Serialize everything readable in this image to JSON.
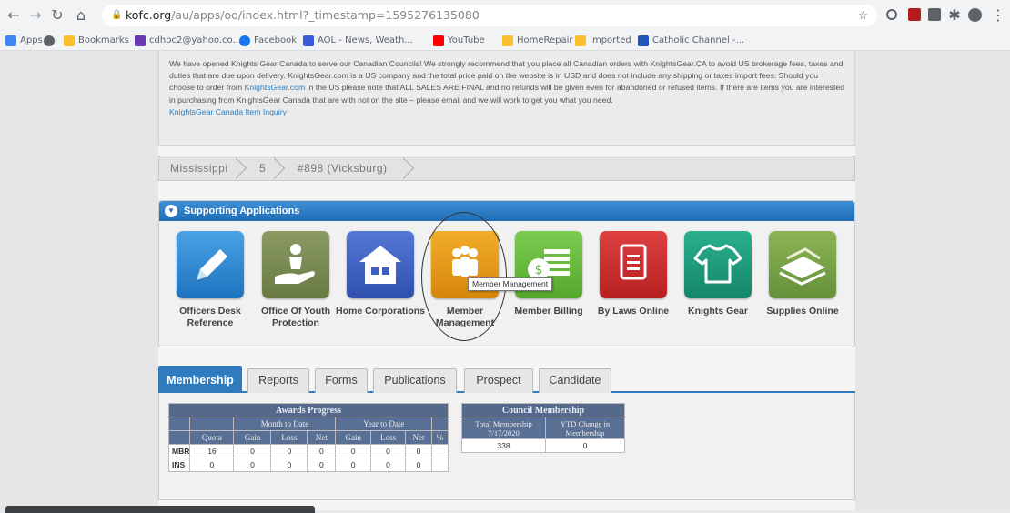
{
  "browser": {
    "url_host": "kofc.org",
    "url_path": "/au/apps/oo/index.html?_timestamp=1595276135080",
    "bookmarks": [
      {
        "label": "Apps",
        "color": "#4285f4"
      },
      {
        "label": "",
        "color": "#5f6368"
      },
      {
        "label": "Bookmarks",
        "color": "#fbc02d"
      },
      {
        "label": "cdhpc2@yahoo.co...",
        "color": "#6a3ab5"
      },
      {
        "label": "Facebook",
        "color": "#1877f2"
      },
      {
        "label": "AOL - News, Weath...",
        "color": "#3b5bdb"
      },
      {
        "label": "YouTube",
        "color": "#ff0000"
      },
      {
        "label": "HomeRepair",
        "color": "#fbc02d"
      },
      {
        "label": "Imported",
        "color": "#fbc02d"
      },
      {
        "label": "Catholic Channel -...",
        "color": "#2255bb"
      }
    ]
  },
  "notice": {
    "text": "We have opened Knights Gear Canada to serve our Canadian Councils! We strongly recommend that you place all Canadian orders with KnightsGear.CA to avoid US brokerage fees, taxes and duties that are due upon delivery. KnightsGear.com is a US company and the total price paid on the website is in USD and does not include any shipping or taxes import fees. Should you choose to order from ",
    "link1": "KnightsGear.com",
    "text2": " in the US please note that ALL SALES ARE FINAL and no refunds will be given even for abandoned or refused items. If there are items you are interested in purchasing from KnightsGear Canada that are with not on the site – please email and we will work to get you what you need.",
    "link2": "KnightsGear Canada Item Inquiry"
  },
  "breadcrumb": [
    "Mississippi",
    "5",
    "#898 (Vicksburg)"
  ],
  "apps": {
    "header": "Supporting Applications",
    "items": [
      {
        "label": "Officers Desk Reference",
        "icon": "pencil-icon",
        "color": "#2f86cf"
      },
      {
        "label": "Office Of Youth Protection",
        "icon": "hand-child-icon",
        "color": "#7a8a52"
      },
      {
        "label": "Home Corporations",
        "icon": "house-icon",
        "color": "#3f5fc0"
      },
      {
        "label": "Member Management",
        "icon": "people-icon",
        "color": "#e69a12"
      },
      {
        "label": "Member Billing",
        "icon": "coins-icon",
        "color": "#66b93c"
      },
      {
        "label": "By Laws Online",
        "icon": "document-icon",
        "color": "#cc3030"
      },
      {
        "label": "Knights Gear",
        "icon": "shirt-icon",
        "color": "#1f9a7c"
      },
      {
        "label": "Supplies Online",
        "icon": "papers-icon",
        "color": "#7aa345"
      }
    ],
    "tooltip": "Member Management"
  },
  "tabs": [
    "Membership",
    "Reports",
    "Forms",
    "Publications",
    "Prospect",
    "Candidate"
  ],
  "awards": {
    "title": "Awards Progress",
    "group1": "Month to Date",
    "group2": "Year to Date",
    "cols": [
      "Quota",
      "Gain",
      "Loss",
      "Net",
      "Gain",
      "Loss",
      "Net",
      "%"
    ],
    "rows": [
      {
        "label": "MBR",
        "values": [
          "16",
          "0",
          "0",
          "0",
          "0",
          "0",
          "0",
          ""
        ]
      },
      {
        "label": "INS",
        "values": [
          "0",
          "0",
          "0",
          "0",
          "0",
          "0",
          "0",
          ""
        ]
      }
    ]
  },
  "council": {
    "title": "Council Membership",
    "col1": "Total Membership 7/17/2020",
    "col2": "YTD Change in Membership",
    "val1": "338",
    "val2": "0"
  }
}
